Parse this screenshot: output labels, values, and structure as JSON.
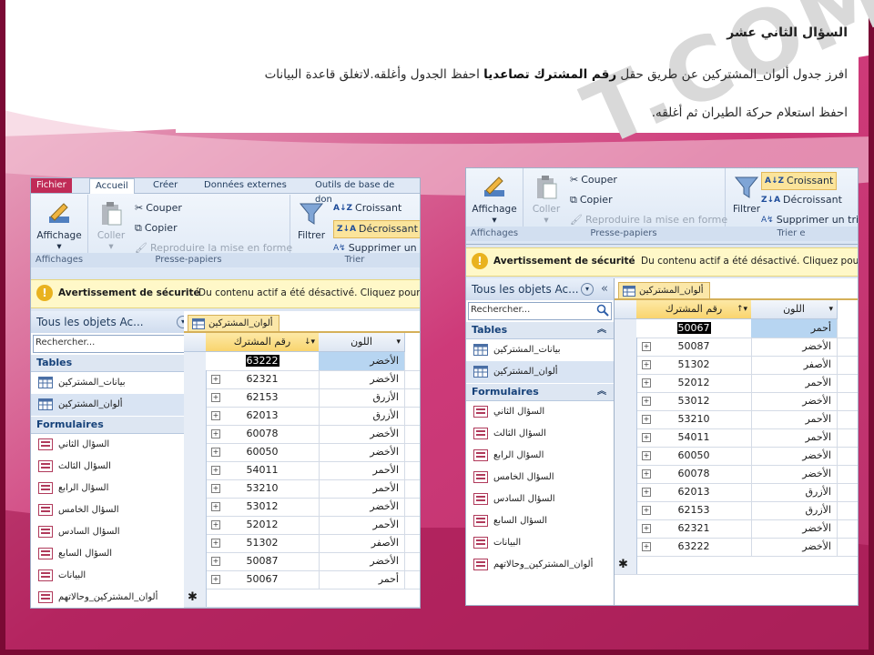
{
  "question": {
    "title": "السؤال الثاني عشر",
    "line1_a": "افرز جدول ألوان_المشتركين عن طريق حقل",
    "line1_bold": "رقم المشترك تصاعديا",
    "line1_b": "احفظ الجدول وأغلقه.لاتغلق قاعدة البيانات",
    "line2": "احفظ استعلام حركة الطيران ثم أغلقه."
  },
  "watermark": "T.COM",
  "ribbon": {
    "tabs": [
      "Fichier",
      "Accueil",
      "Créer",
      "Données externes",
      "Outils de base de don"
    ],
    "affichage": "Affichage",
    "affichages_group": "Affichages",
    "coller": "Coller",
    "couper": "Couper",
    "copier": "Copier",
    "reproduire": "Reproduire la mise en forme",
    "presse_group": "Presse-papiers",
    "filtrer": "Filtrer",
    "croissant": "Croissant",
    "decroissant": "Décroissant",
    "supprimer_left": "Supprimer un t",
    "supprimer_right": "Supprimer un tri",
    "trier_left": "Trier",
    "trier_right": "Trier e"
  },
  "security": {
    "title": "Avertissement de sécurité",
    "message_left": "Du contenu actif a été désactivé. Cliquez pour p",
    "message_right": "Du contenu actif a été désactivé. Cliquez pour pl"
  },
  "nav": {
    "header_left": "Tous les objets Ac...",
    "header_right": "Tous les objets Ac...",
    "search_placeholder": "Rechercher...",
    "tables_label": "Tables",
    "forms_label": "Formulaires",
    "tables": [
      "بيانات_المشتركين",
      "ألوان_المشتركين"
    ],
    "forms": [
      "السؤال الثاني",
      "السؤال الثالث",
      "السؤال الرابع",
      "السؤال الخامس",
      "السؤال السادس",
      "السؤال السابع",
      "البيانات",
      "ألوان_المشتركين_وحالاتهم"
    ]
  },
  "table": {
    "tab_name": "ألوان_المشتركين",
    "col_number": "رقم المشترك",
    "col_color": "اللون",
    "left_rows": [
      {
        "num": "63222",
        "color": "الأخضر"
      },
      {
        "num": "62321",
        "color": "الأخضر"
      },
      {
        "num": "62153",
        "color": "الأزرق"
      },
      {
        "num": "62013",
        "color": "الأزرق"
      },
      {
        "num": "60078",
        "color": "الأخضر"
      },
      {
        "num": "60050",
        "color": "الأخضر"
      },
      {
        "num": "54011",
        "color": "الأحمر"
      },
      {
        "num": "53210",
        "color": "الأحمر"
      },
      {
        "num": "53012",
        "color": "الأخضر"
      },
      {
        "num": "52012",
        "color": "الأحمر"
      },
      {
        "num": "51302",
        "color": "الأصفر"
      },
      {
        "num": "50087",
        "color": "الأخضر"
      },
      {
        "num": "50067",
        "color": "أحمر"
      }
    ],
    "right_rows": [
      {
        "num": "50067",
        "color": "أحمر"
      },
      {
        "num": "50087",
        "color": "الأخضر"
      },
      {
        "num": "51302",
        "color": "الأصفر"
      },
      {
        "num": "52012",
        "color": "الأحمر"
      },
      {
        "num": "53012",
        "color": "الأخضر"
      },
      {
        "num": "53210",
        "color": "الأحمر"
      },
      {
        "num": "54011",
        "color": "الأحمر"
      },
      {
        "num": "60050",
        "color": "الأخضر"
      },
      {
        "num": "60078",
        "color": "الأخضر"
      },
      {
        "num": "62013",
        "color": "الأزرق"
      },
      {
        "num": "62153",
        "color": "الأزرق"
      },
      {
        "num": "62321",
        "color": "الأخضر"
      },
      {
        "num": "63222",
        "color": "الأخضر"
      }
    ]
  },
  "colors": {
    "accent": "#c8246a",
    "highlight": "#fbe49b",
    "selected_row": "#b7d5f1"
  }
}
